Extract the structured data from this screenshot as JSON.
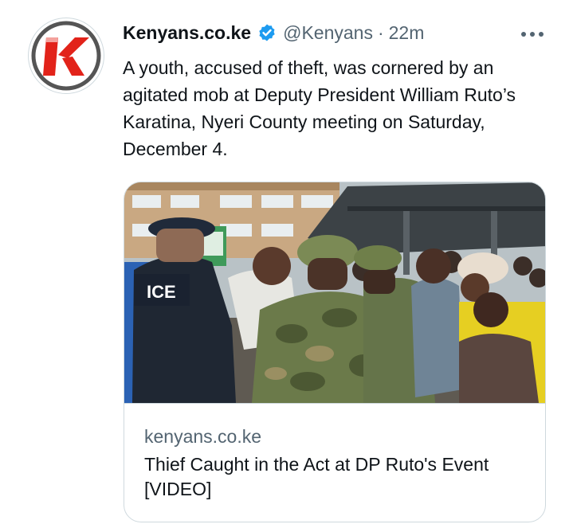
{
  "tweet": {
    "author_name": "Kenyans.co.ke",
    "author_handle": "@Kenyans",
    "separator": "·",
    "time": "22m",
    "text": "A youth, accused of theft, was cornered by an agitated mob at Deputy President William Ruto’s Karatina, Nyeri County meeting on Saturday, December 4."
  },
  "card": {
    "domain": "kenyans.co.ke",
    "title": "Thief Caught in the Act at DP Ruto's Event [VIDEO]",
    "image_badge_text": "ICE"
  },
  "colors": {
    "brand_red": "#e2231a",
    "verified_blue": "#1d9bf0",
    "text_primary": "#0f1419",
    "text_secondary": "#536471",
    "border": "#cfd9de"
  },
  "icons": {
    "avatar": "kenyans-logo-icon",
    "verified": "verified-badge-icon",
    "more": "more-options-icon"
  }
}
